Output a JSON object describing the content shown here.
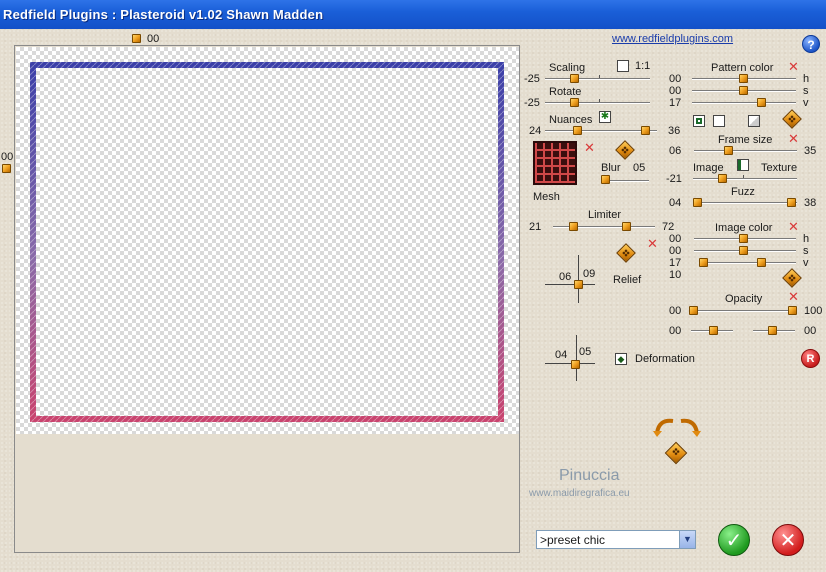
{
  "title": "Redfield Plugins : Plasteroid v1.02   Shawn Madden",
  "link": "www.redfieldplugins.com",
  "help_label": "?",
  "preview": {
    "top_value": "00",
    "left_value": "00"
  },
  "scaling": {
    "label": "Scaling",
    "ratio_label": "1:1",
    "value": "-25"
  },
  "rotate": {
    "label": "Rotate",
    "value": "-25"
  },
  "nuances": {
    "label": "Nuances",
    "min": "24",
    "max": "36"
  },
  "mesh": {
    "label": "Mesh"
  },
  "blur": {
    "label": "Blur",
    "value": "05"
  },
  "limiter": {
    "label": "Limiter",
    "min": "21",
    "max": "72"
  },
  "relief": {
    "label": "Relief",
    "x": "06",
    "y": "09"
  },
  "deformation": {
    "label": "Deformation",
    "x": "04",
    "y": "05"
  },
  "pattern_color": {
    "label": "Pattern color",
    "h": "00",
    "s": "00",
    "v": "17",
    "h_l": "h",
    "s_l": "s",
    "v_l": "v"
  },
  "frame_size": {
    "label": "Frame size",
    "min": "06",
    "max": "35"
  },
  "image_texture": {
    "image_label": "Image",
    "texture_label": "Texture",
    "value": "-21"
  },
  "fuzz": {
    "label": "Fuzz",
    "min": "04",
    "max": "38"
  },
  "image_color": {
    "label": "Image color",
    "h": "00",
    "s": "00",
    "v": "17",
    "extra": "10",
    "h_l": "h",
    "s_l": "s",
    "v_l": "v"
  },
  "opacity": {
    "label": "Opacity",
    "min": "00",
    "max": "100",
    "min2": "00",
    "max2": "00"
  },
  "reset_label": "R",
  "watermark": {
    "name": "Pinuccia",
    "site": "www.maidiregrafica.eu"
  },
  "preset": {
    "selected": ">preset chic"
  },
  "ok_label": "✓",
  "cancel_label": "✕",
  "colors": {
    "title_bg": "#1a5fd8",
    "frame_top": "#3b3fa8",
    "frame_bottom": "#c8436e",
    "accent": "#f0a020"
  }
}
